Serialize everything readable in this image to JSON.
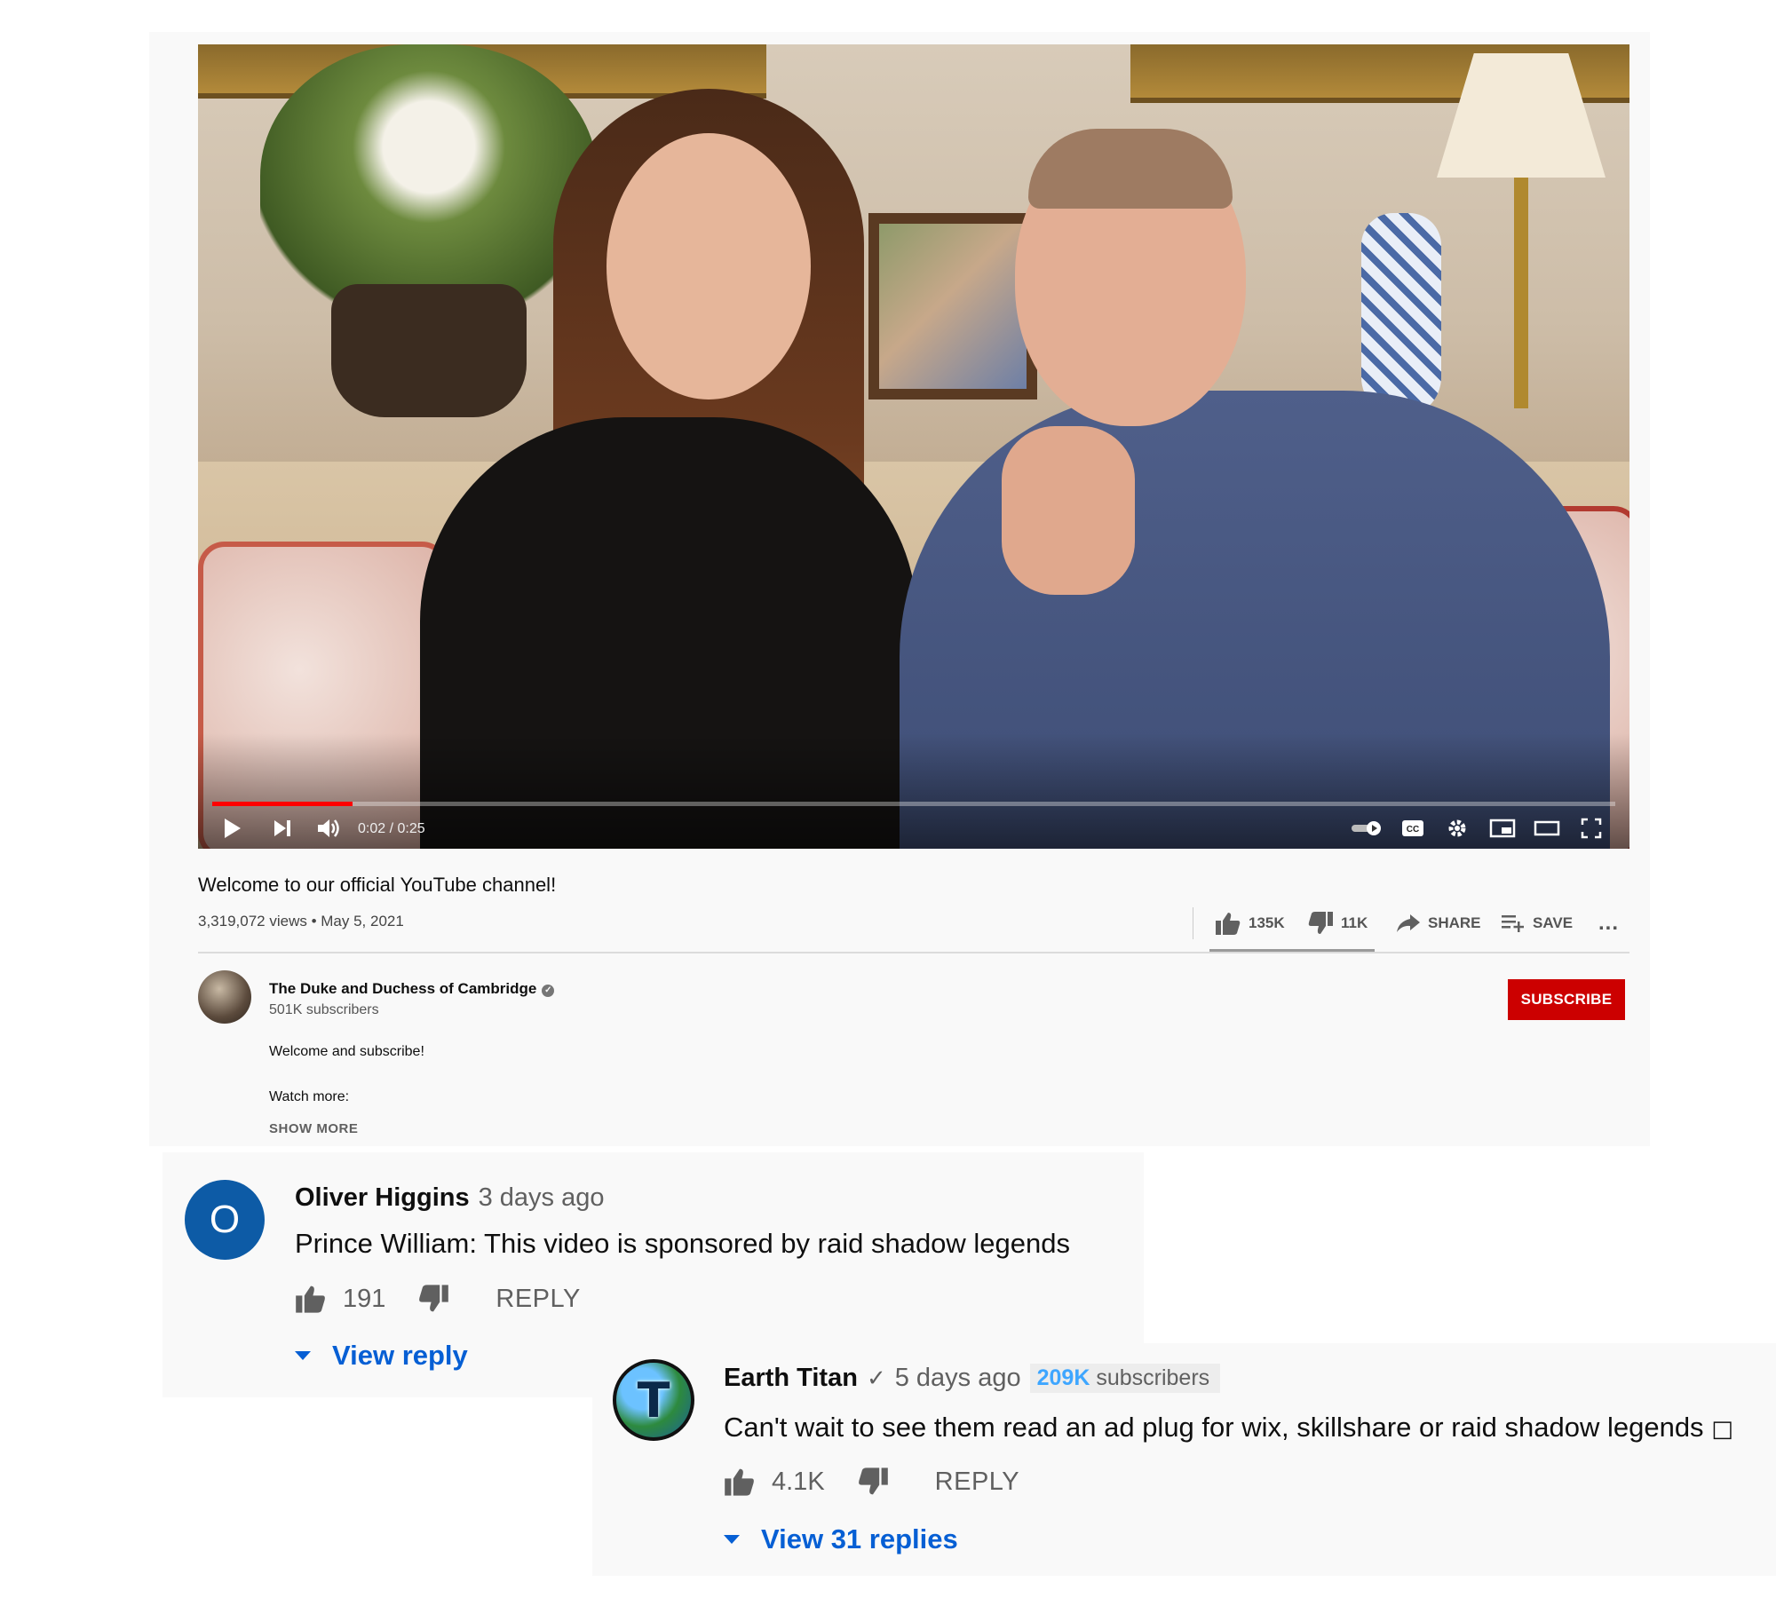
{
  "video": {
    "time_display": "0:02 / 0:25",
    "progress": 0.1,
    "title": "Welcome to our official YouTube channel!",
    "views_date": "3,319,072 views • May 5, 2021",
    "likes": "135K",
    "dislikes": "11K",
    "share_label": "SHARE",
    "save_label": "SAVE",
    "more_label": "..."
  },
  "channel": {
    "name": "The Duke and Duchess of Cambridge",
    "subscribers": "501K subscribers",
    "subscribe_label": "SUBSCRIBE",
    "description_line1": "Welcome and subscribe!",
    "description_line2": "Watch more:",
    "show_more_label": "SHOW MORE"
  },
  "comments": [
    {
      "avatar_letter": "O",
      "author": "Oliver Higgins",
      "time": "3 days ago",
      "text": "Prince William: This video is sponsored by raid shadow legends",
      "likes": "191",
      "reply_label": "REPLY",
      "view_replies": "View reply"
    },
    {
      "avatar_letter": "T",
      "author": "Earth Titan",
      "verified_mark": "✓",
      "time": "5 days ago",
      "subscriber_count": "209K",
      "subscriber_label": "subscribers",
      "text": "Can't wait to see them read an ad plug for wix, skillshare or raid shadow legends",
      "trailing_glyph": "□",
      "likes": "4.1K",
      "reply_label": "REPLY",
      "view_replies": "View 31 replies"
    }
  ],
  "colors": {
    "accent_red": "#ff0000",
    "subscribe_red": "#cc0000",
    "link_blue": "#065fd4",
    "avatar_blue": "#0d5ba6",
    "badge_blue": "#3ea6ff"
  },
  "icons": [
    "play-icon",
    "next-icon",
    "volume-icon",
    "autoplay-toggle-icon",
    "captions-icon",
    "settings-icon",
    "miniplayer-icon",
    "theater-icon",
    "fullscreen-icon",
    "thumb-up-icon",
    "thumb-down-icon",
    "share-icon",
    "save-playlist-icon",
    "more-icon",
    "verified-icon",
    "expand-triangle-icon"
  ]
}
